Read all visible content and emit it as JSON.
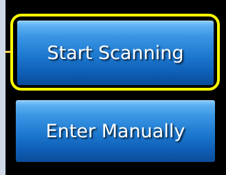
{
  "buttons": {
    "start_scanning": "Start Scanning",
    "enter_manually": "Enter Manually"
  },
  "highlight": {
    "color": "#ffff00",
    "target": "start_scanning"
  },
  "colors": {
    "background": "#cfd9e6",
    "panel": "#000000",
    "button_top": "#8fd0ff",
    "button_bottom": "#0a4c99"
  }
}
